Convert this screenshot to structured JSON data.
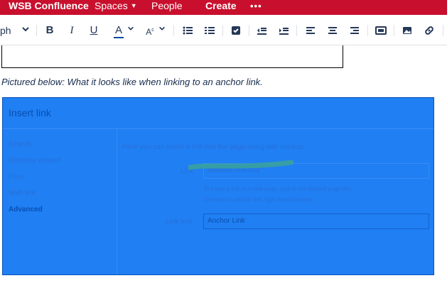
{
  "topbar": {
    "brand": "WSB Confluence",
    "spaces": "Spaces",
    "people": "People",
    "create": "Create",
    "more": "•••"
  },
  "toolbar": {
    "paragraph_label": "ph",
    "highlight_color": "#f7f700",
    "icons": [
      "chevron-down-icon",
      "bold-icon",
      "italic-icon",
      "underline-icon",
      "text-color-icon",
      "more-formatting-icon",
      "bullet-list-icon",
      "numbered-list-icon",
      "task-checkbox-icon",
      "outdent-icon",
      "indent-icon",
      "align-left-icon",
      "align-center-icon",
      "align-right-icon",
      "page-layout-icon",
      "image-icon",
      "link-icon"
    ]
  },
  "document": {
    "caption": "Pictured below: What it looks like when linking to an anchor link."
  },
  "dialog": {
    "title": "Insert link",
    "overlay_color": "#1f7ff3",
    "sidebar": [
      "Search",
      "Recently viewed",
      "Files",
      "Web link",
      "Advanced"
    ],
    "active_item": "Advanced",
    "intro": "Here you can insert a link into the page using wiki markup.",
    "link_label": "Link",
    "link_value": "#anchor-link-text",
    "hint1": "To insert a link to a new page, type in the desired page title.",
    "hint2": "To insert an anchor link, type #anchorname.",
    "link_text_label": "Link text",
    "link_text_value": "Anchor Link"
  }
}
